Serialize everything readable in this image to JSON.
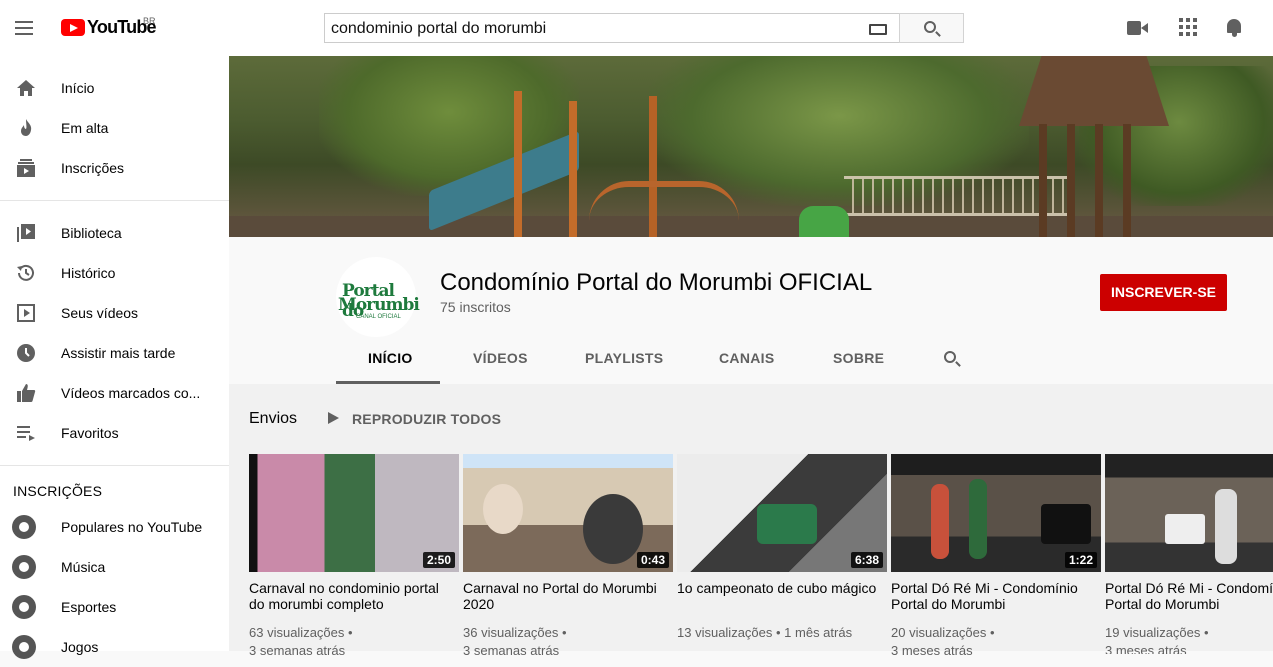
{
  "topbar": {
    "logo_text": "YouTube",
    "country": "BR",
    "search_value": "condominio portal do morumbi"
  },
  "sidebar": {
    "main_items": [
      {
        "label": "Início",
        "icon": "home-icon"
      },
      {
        "label": "Em alta",
        "icon": "flame-icon"
      },
      {
        "label": "Inscrições",
        "icon": "subscriptions-icon"
      }
    ],
    "library_items": [
      {
        "label": "Biblioteca",
        "icon": "library-icon"
      },
      {
        "label": "Histórico",
        "icon": "history-icon"
      },
      {
        "label": "Seus vídeos",
        "icon": "your-videos-icon"
      },
      {
        "label": "Assistir mais tarde",
        "icon": "watch-later-icon"
      },
      {
        "label": "Vídeos marcados co...",
        "icon": "thumbs-up-icon"
      },
      {
        "label": "Favoritos",
        "icon": "playlist-icon"
      }
    ],
    "subscriptions_heading": "INSCRIÇÕES",
    "subscriptions": [
      {
        "label": "Populares no YouTube"
      },
      {
        "label": "Música"
      },
      {
        "label": "Esportes"
      },
      {
        "label": "Jogos"
      }
    ]
  },
  "channel": {
    "avatar_line1": "Portal do",
    "avatar_line2": "Morumbi",
    "avatar_line3": "CANAL OFICIAL",
    "title": "Condomínio Portal do Morumbi OFICIAL",
    "subscribers": "75 inscritos",
    "subscribe_label": "INSCREVER-SE",
    "tabs": [
      "INÍCIO",
      "VÍDEOS",
      "PLAYLISTS",
      "CANAIS",
      "SOBRE"
    ],
    "active_tab": "INÍCIO"
  },
  "uploads": {
    "title": "Envios",
    "play_all_label": "REPRODUZIR TODOS",
    "videos": [
      {
        "title": "Carnaval no condominio portal do morumbi completo",
        "duration": "2:50",
        "views": "63 visualizações",
        "age": "3 semanas atrás"
      },
      {
        "title": "Carnaval no Portal do Morumbi 2020",
        "duration": "0:43",
        "views": "36 visualizações",
        "age": "3 semanas atrás"
      },
      {
        "title": "1o campeonato de cubo mágico",
        "duration": "6:38",
        "views": "13 visualizações",
        "age": "1 mês atrás"
      },
      {
        "title": "Portal Dó Ré Mi - Condomínio Portal do Morumbi",
        "duration": "1:22",
        "views": "20 visualizações",
        "age": "3 meses atrás"
      },
      {
        "title": "Portal Dó Ré Mi - Condomínio Portal do Morumbi",
        "duration": "",
        "views": "19 visualizações",
        "age": "3 meses atrás"
      }
    ]
  },
  "colors": {
    "brand_red": "#ff0000",
    "subscribe_red": "#cc0000",
    "text_secondary": "#606060"
  }
}
